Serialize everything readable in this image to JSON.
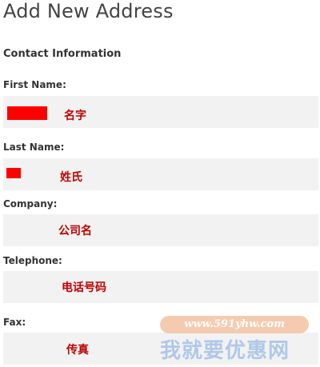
{
  "page": {
    "title": "Add New Address"
  },
  "contact_section": {
    "title": "Contact Information"
  },
  "fields": {
    "first_name": {
      "label": "First Name:",
      "note": "名字"
    },
    "last_name": {
      "label": "Last Name:",
      "note": "姓氏"
    },
    "company": {
      "label": "Company:",
      "note": "公司名"
    },
    "telephone": {
      "label": "Telephone:",
      "note": "电话号码"
    },
    "fax": {
      "label": "Fax:",
      "note": "传真"
    }
  },
  "watermark": {
    "url": "www.591yhw.com",
    "logo_text": "我就要优惠网"
  },
  "colors": {
    "redaction": "#ff0000",
    "annotation": "#c00000",
    "field_background": "#f3f2f2"
  }
}
